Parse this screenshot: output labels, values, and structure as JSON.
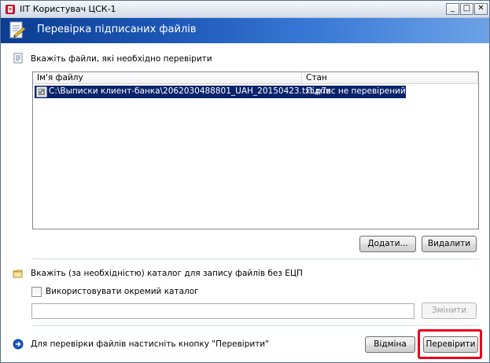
{
  "window": {
    "title": "ІІТ Користувач ЦСК-1",
    "min_glyph": "_",
    "max_glyph": "□",
    "close_glyph": "✕"
  },
  "banner": {
    "title": "Перевірка підписаних файлів",
    "colors": {
      "start": "#0b3d91",
      "end": "#6da2e6"
    }
  },
  "files_section": {
    "instruction": "Вкажіть файли, які необхідно перевірити",
    "columns": [
      "Ім'я файлу",
      "Стан"
    ],
    "rows": [
      {
        "file": "C:\\Выписки клиент-банка\\2062030488801_UAH_20150423.txt.p7s",
        "status": "Підпис не перевірений"
      }
    ],
    "add_button": "Додати...",
    "remove_button": "Видалити"
  },
  "folder_section": {
    "instruction": "Вкажіть (за необхідністю) каталог для запису файлів без ЕЦП",
    "checkbox_label": "Використовувати окремий каталог",
    "checkbox_checked": false,
    "path_value": "",
    "change_button": "Змінити"
  },
  "footer": {
    "hint": "Для перевірки файлів настисніть кнопку \"Перевірити\"",
    "cancel_button": "Відміна",
    "verify_button": "Перевірити",
    "highlight_color": "#e8001c"
  }
}
